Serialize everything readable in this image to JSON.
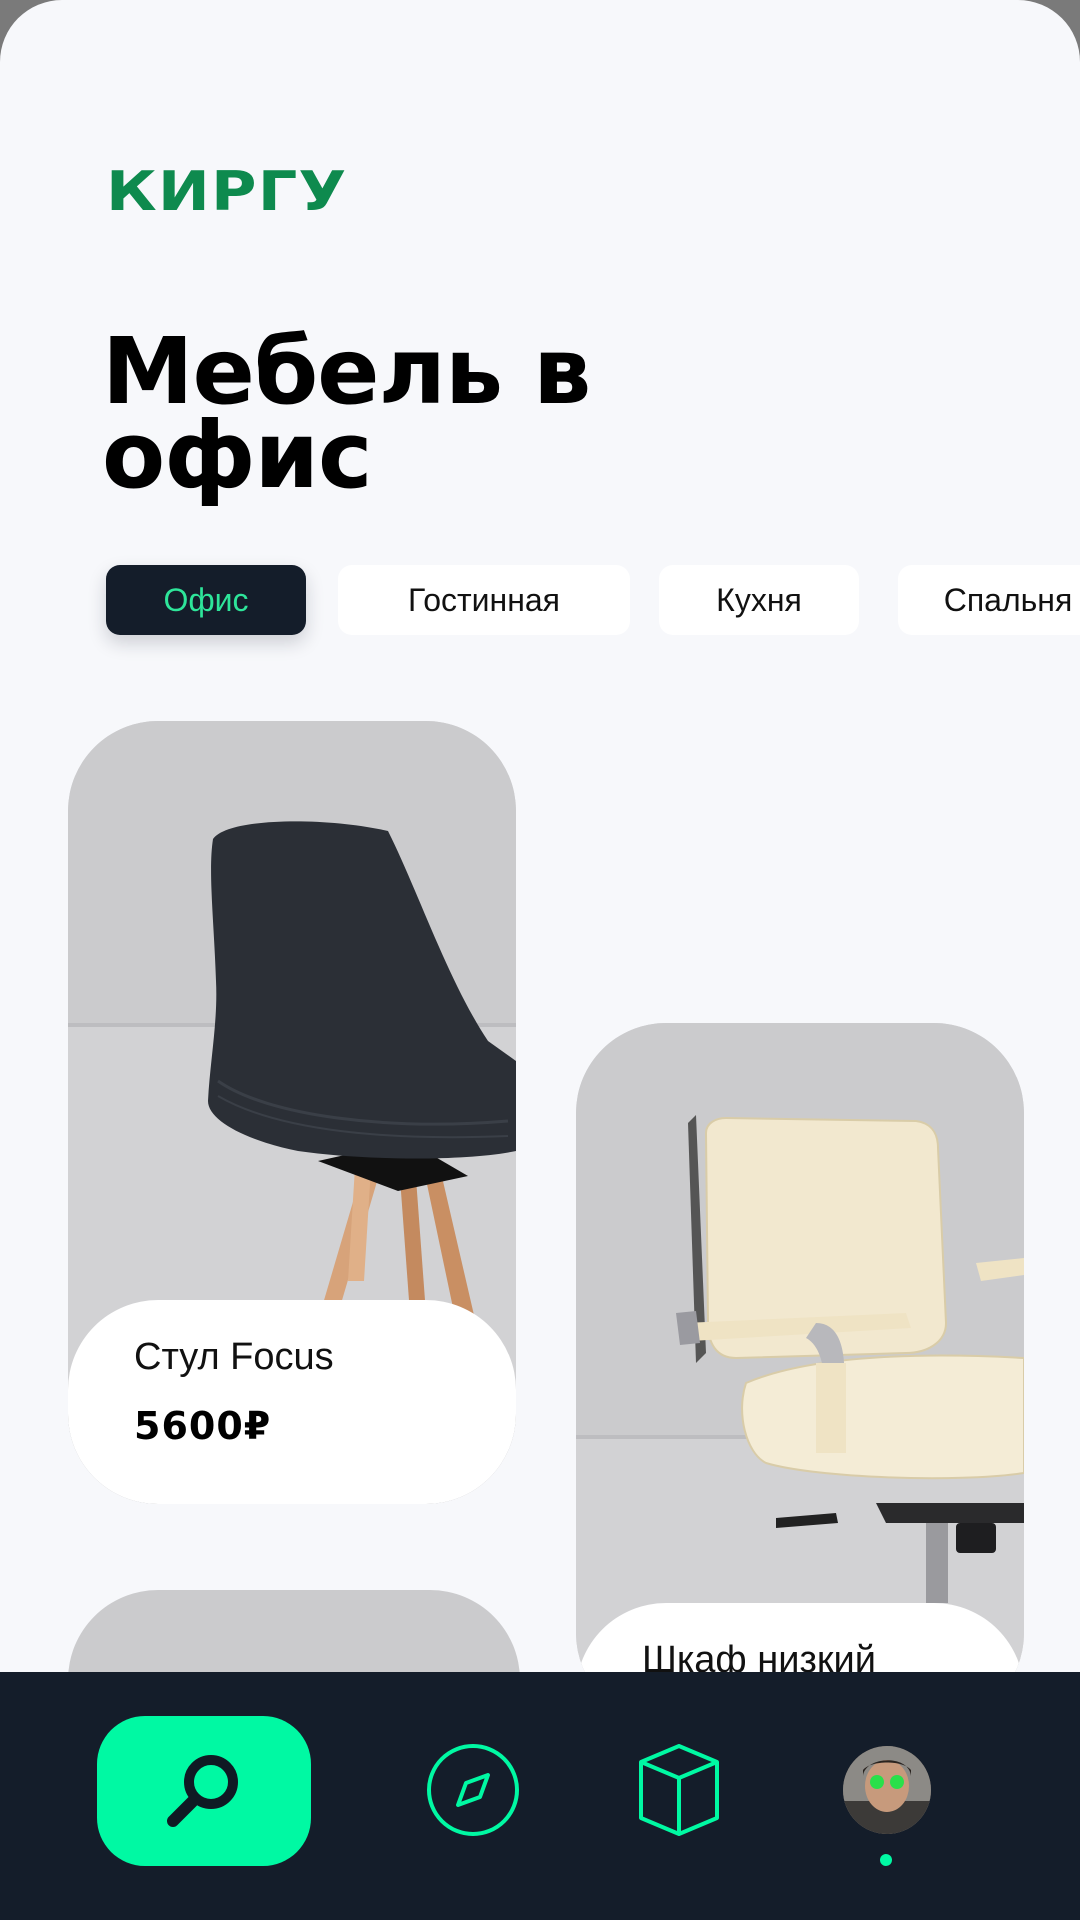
{
  "brand": {
    "logo": "КИРГУ",
    "logo_color": "#0e8a4e"
  },
  "page": {
    "title": "Мебель в офис"
  },
  "categories": [
    {
      "label": "Офис",
      "active": true
    },
    {
      "label": "Гостинная",
      "active": false
    },
    {
      "label": "Кухня",
      "active": false
    },
    {
      "label": "Спальня",
      "active": false
    }
  ],
  "products": [
    {
      "name": "Стул Focus",
      "price": "5600₽",
      "image": "black-chair-image"
    },
    {
      "name": "Шкаф низкий",
      "image": "office-armchair-image"
    },
    {
      "image": "product-image"
    }
  ],
  "navbar": {
    "items": [
      {
        "icon": "search-icon",
        "active": true
      },
      {
        "icon": "compass-icon",
        "active": false
      },
      {
        "icon": "cube-icon",
        "active": false
      },
      {
        "icon": "avatar",
        "active": false
      }
    ],
    "accent": "#00f9a3",
    "background": "#141d2a"
  }
}
